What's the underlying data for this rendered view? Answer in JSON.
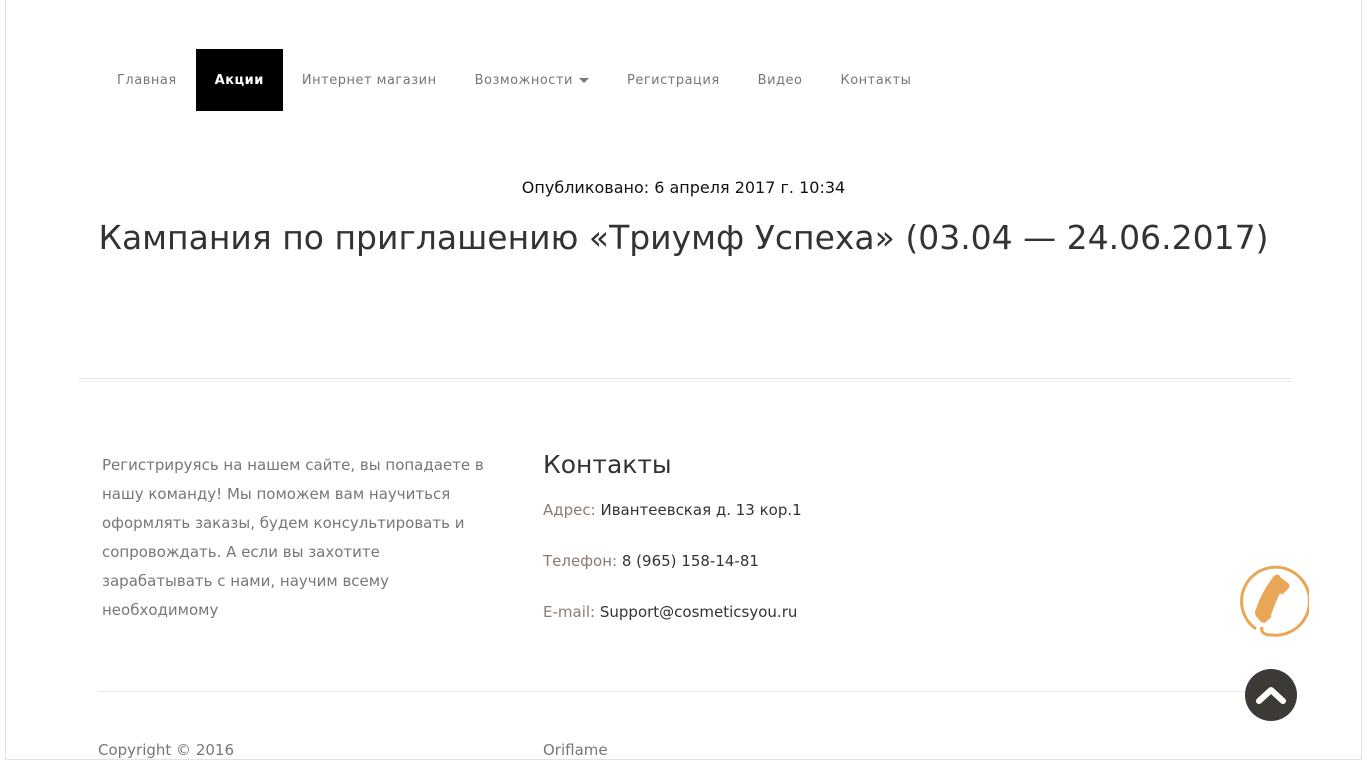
{
  "nav": {
    "items": [
      {
        "label": "Главная"
      },
      {
        "label": "Акции"
      },
      {
        "label": "Интернет магазин"
      },
      {
        "label": "Возможности"
      },
      {
        "label": "Регистрация"
      },
      {
        "label": "Видео"
      },
      {
        "label": "Контакты"
      }
    ]
  },
  "article": {
    "published": "Опубликовано: 6 апреля 2017 г. 10:34",
    "title": "Кампания по приглашению «Триумф Успеха» (03.04 — 24.06.2017)"
  },
  "footer": {
    "about": "Регистрируясь на нашем сайте, вы попадаете в нашу команду! Мы поможем вам научиться оформлять заказы, будем консультировать и сопровождать. А если вы захотите зарабатывать с нами, научим всему необходимому",
    "contacts_title": "Контакты",
    "address_label": "Адрес:",
    "address": "Ивантеевская д. 13 кор.1",
    "phone_label": "Телефон:",
    "phone": "8 (965) 158-14-81",
    "email_label": "E-mail:",
    "email": "Support@cosmeticsyou.ru",
    "copyright": "Copyright © 2016",
    "right": "Oriflame"
  },
  "colors": {
    "accent": "#eaa657",
    "dark": "#3d3935"
  }
}
